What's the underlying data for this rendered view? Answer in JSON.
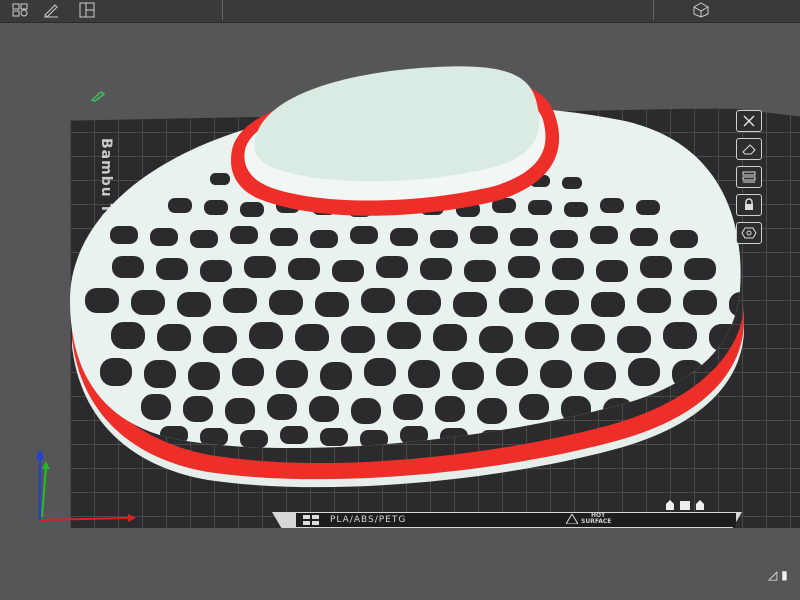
{
  "plate": {
    "label": "Bambu Textu",
    "material": "PLA/ABS/PETG",
    "warning_line1": "HOT",
    "warning_line2": "SURFACE"
  },
  "toolbar": {
    "icons": [
      "grid-icon",
      "pencil-icon",
      "layout-icon",
      "cube-icon"
    ]
  },
  "side_tools": [
    "close-icon",
    "eraser-icon",
    "layers-icon",
    "lock-icon",
    "settings-hex-icon"
  ],
  "model": {
    "lattice_color": "#e9f2ee",
    "band_color": "#ee2e28",
    "top_color": "#d9ebe3"
  },
  "colors": {
    "plate": "#2b2b2d",
    "grid": "#4a4a4d",
    "axis_x": "#e02020",
    "axis_y": "#20c020",
    "axis_z": "#2040e0"
  }
}
